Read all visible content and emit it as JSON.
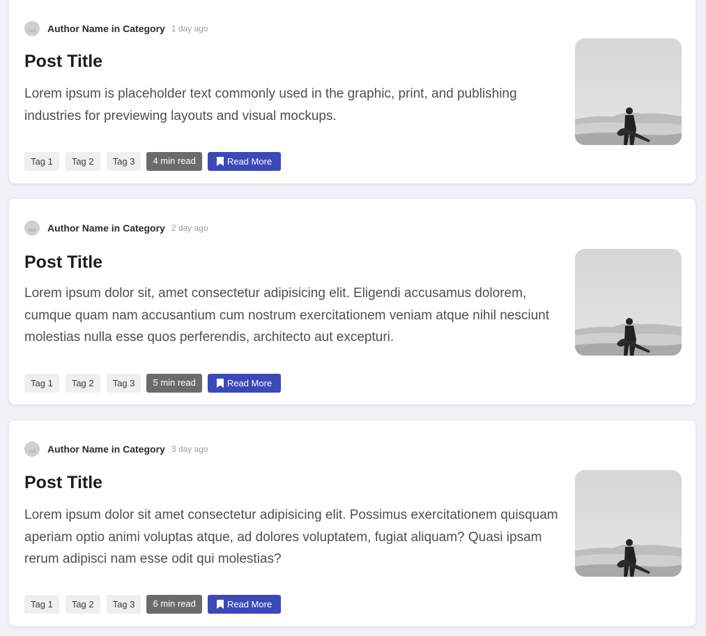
{
  "posts": [
    {
      "author_line": "Author Name in Category",
      "time": "1 day ago",
      "title": "Post Title",
      "excerpt": "Lorem ipsum is placeholder text commonly used in the graphic, print, and publishing industries for previewing layouts and visual mockups.",
      "tags": [
        "Tag 1",
        "Tag 2",
        "Tag 3"
      ],
      "read_time": "4 min read",
      "read_more_label": "Read More",
      "avatar_text": "1x2"
    },
    {
      "author_line": "Author Name in Category",
      "time": "2 day ago",
      "title": "Post Title",
      "excerpt": "Lorem ipsum dolor sit, amet consectetur adipisicing elit. Eligendi accusamus dolorem, cumque quam nam accusantium cum nostrum exercitationem veniam atque nihil nesciunt molestias nulla esse quos perferendis, architecto aut excepturi.",
      "tags": [
        "Tag 1",
        "Tag 2",
        "Tag 3"
      ],
      "read_time": "5 min read",
      "read_more_label": "Read More",
      "avatar_text": "1x2"
    },
    {
      "author_line": "Author Name in Category",
      "time": "3 day ago",
      "title": "Post Title",
      "excerpt": "Lorem ipsum dolor sit amet consectetur adipisicing elit. Possimus exercitationem quisquam aperiam optio animi voluptas atque, ad dolores voluptatem, fugiat aliquam? Quasi ipsam rerum adipisci nam esse odit qui molestias?",
      "tags": [
        "Tag 1",
        "Tag 2",
        "Tag 3"
      ],
      "read_time": "6 min read",
      "read_more_label": "Read More",
      "avatar_text": "1x2"
    }
  ],
  "icons": {
    "read_more": "bookmark-icon",
    "thumbnail": "guitarist-photo"
  },
  "colors": {
    "page_bg": "#eff1f5",
    "card_bg": "#ffffff",
    "primary_button": "#3a49b8",
    "read_time_badge": "#6b6b6b",
    "tag_bg": "#efefef"
  }
}
